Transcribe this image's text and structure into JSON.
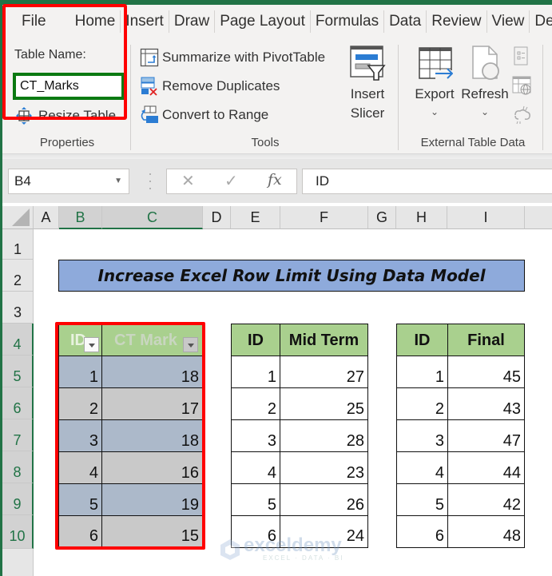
{
  "menu": {
    "tabs": [
      "File",
      "Home",
      "Insert",
      "Draw",
      "Page Layout",
      "Formulas",
      "Data",
      "Review",
      "View",
      "De"
    ]
  },
  "ribbon": {
    "properties": {
      "table_name_label": "Table Name:",
      "table_name_value": "CT_Marks",
      "resize_table": "Resize Table",
      "group_label": "Properties"
    },
    "tools": {
      "summarize": "Summarize with PivotTable",
      "remove_duplicates": "Remove Duplicates",
      "convert_to_range": "Convert to Range",
      "insert_slicer_line1": "Insert",
      "insert_slicer_line2": "Slicer",
      "group_label": "Tools"
    },
    "external": {
      "export": "Export",
      "refresh": "Refresh",
      "chevron": "⌄",
      "group_label": "External Table Data"
    }
  },
  "formula_bar": {
    "name_box": "B4",
    "cancel_icon": "✕",
    "enter_icon": "✓",
    "fx_icon": "fx",
    "formula": "ID"
  },
  "grid": {
    "columns": [
      "A",
      "B",
      "C",
      "D",
      "E",
      "F",
      "G",
      "H",
      "I"
    ],
    "rows": [
      "1",
      "2",
      "3",
      "4",
      "5",
      "6",
      "7",
      "8",
      "9",
      "10"
    ],
    "selected_columns": [
      "B",
      "C"
    ],
    "selected_row": "4"
  },
  "title": "Increase Excel Row Limit Using Data Model",
  "tables": {
    "ct_marks": {
      "headers": [
        "ID",
        "CT Marks"
      ],
      "header_display": [
        "ID",
        "CT Mark"
      ],
      "rows": [
        [
          "1",
          "18"
        ],
        [
          "2",
          "17"
        ],
        [
          "3",
          "18"
        ],
        [
          "4",
          "16"
        ],
        [
          "5",
          "19"
        ],
        [
          "6",
          "15"
        ]
      ]
    },
    "mid_term": {
      "headers": [
        "ID",
        "Mid Term"
      ],
      "rows": [
        [
          "1",
          "27"
        ],
        [
          "2",
          "25"
        ],
        [
          "3",
          "28"
        ],
        [
          "4",
          "23"
        ],
        [
          "5",
          "26"
        ],
        [
          "6",
          "24"
        ]
      ]
    },
    "final": {
      "headers": [
        "ID",
        "Final"
      ],
      "rows": [
        [
          "1",
          "45"
        ],
        [
          "2",
          "43"
        ],
        [
          "3",
          "47"
        ],
        [
          "4",
          "44"
        ],
        [
          "5",
          "42"
        ],
        [
          "6",
          "48"
        ]
      ]
    }
  },
  "watermark": {
    "name": "exceldemy",
    "tagline": "EXCEL · DATA · BI"
  },
  "colors": {
    "excel_green": "#217346",
    "highlight_red": "#ff0000",
    "input_outline_green": "#0b7a12",
    "title_fill": "#8eaadb",
    "header_fill": "#a9d08e",
    "band_blue": "#acb9ca",
    "band_gray": "#c9c9c9"
  }
}
